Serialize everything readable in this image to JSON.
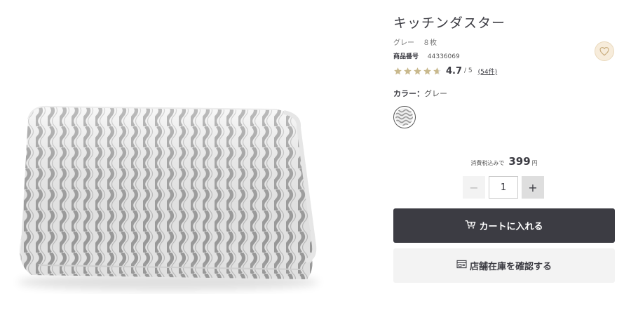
{
  "product": {
    "title": "キッチンダスター",
    "color_short": "グレー",
    "quantity_text": "８枚",
    "sku_label": "商品番号",
    "sku_value": "44336069",
    "image_icon": "folded-cloth-image"
  },
  "rating": {
    "value": "4.7",
    "max": "/ 5",
    "reviews": "(54件)",
    "stars_filled": 4.7,
    "star_color": "#c9b98d"
  },
  "color": {
    "label": "カラー：",
    "value": "グレー"
  },
  "price": {
    "label": "消費税込みで",
    "value": "399",
    "unit": "円"
  },
  "quantity": {
    "minus": "−",
    "value": "1",
    "plus": "+"
  },
  "actions": {
    "cart_label": "カートに入れる",
    "cart_icon": "cart-icon",
    "store_label": "店舗在庫を確認する",
    "store_icon": "store-icon",
    "favorite_icon": "heart-icon"
  },
  "colors": {
    "dark": "#3c3c43",
    "light_button": "#f3f3f3",
    "favorite_bg": "#f7ecdb"
  }
}
